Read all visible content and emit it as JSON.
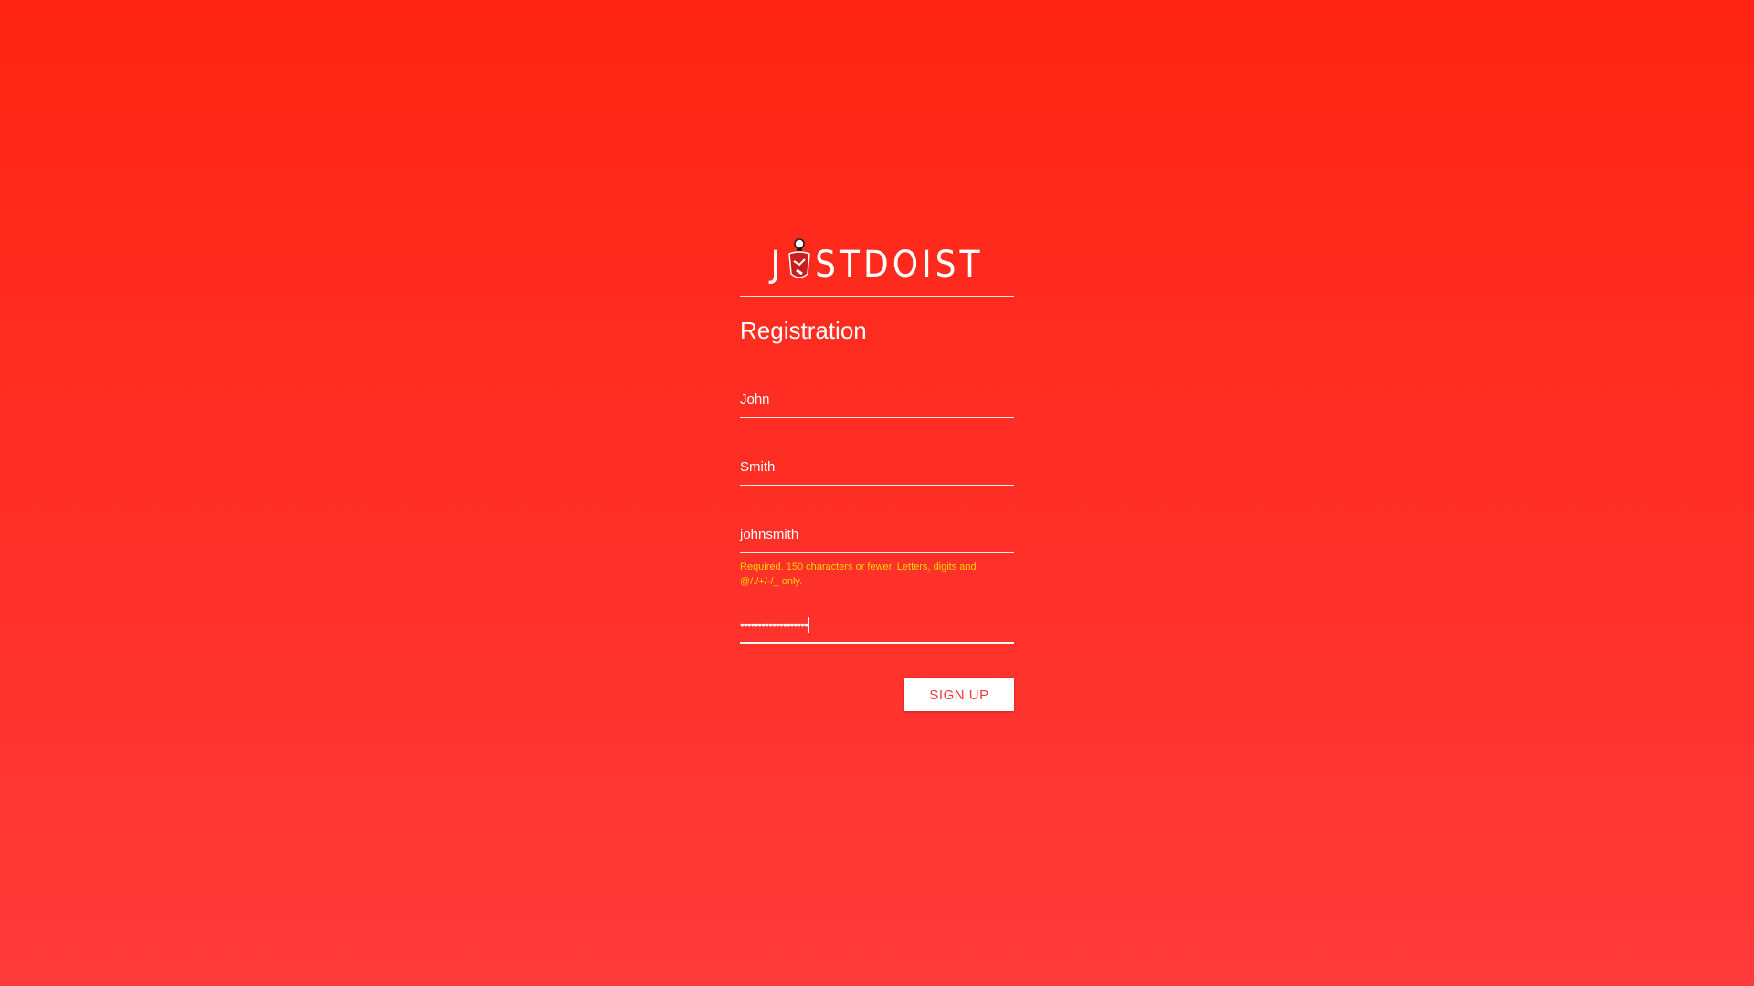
{
  "logo": {
    "prefix": "J",
    "suffix": "STDOIST"
  },
  "form": {
    "title": "Registration",
    "first_name": {
      "value": "John"
    },
    "last_name": {
      "value": "Smith"
    },
    "username": {
      "value": "johnsmith",
      "help": "Required. 150 characters or fewer. Letters, digits and @/./+/-/_ only."
    },
    "password": {
      "value": "•••••••••••••••••••"
    },
    "submit_label": "SIGN UP"
  },
  "colors": {
    "background_top": "#ff2412",
    "background_bottom": "#ff3a3a",
    "help_text": "#ffd400",
    "button_text": "#f03a3a"
  }
}
